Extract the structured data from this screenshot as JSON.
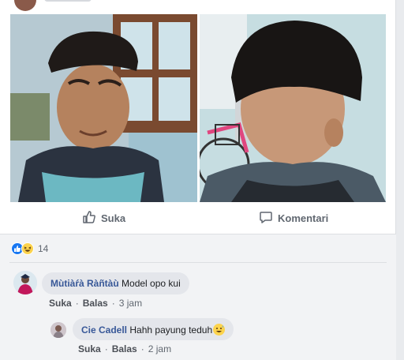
{
  "actions": {
    "like_label": "Suka",
    "comment_label": "Komentari"
  },
  "reactions": {
    "count": "14",
    "types": [
      "like-icon",
      "haha-icon"
    ]
  },
  "comments": [
    {
      "author": "Mùtiàŕà Ràñtàù",
      "text": "Model opo kui",
      "like_label": "Suka",
      "reply_label": "Balas",
      "time": "3 jam"
    },
    {
      "author": "Cie Cadell",
      "text": "Hahh payung teduh",
      "emoji": "grinning-sweat-emoji",
      "like_label": "Suka",
      "reply_label": "Balas",
      "time": "2 jam"
    }
  ],
  "colors": {
    "link_blue": "#385898",
    "like_blue": "#1877f2",
    "meta_gray": "#606770",
    "bubble_bg": "#e4e6eb"
  }
}
